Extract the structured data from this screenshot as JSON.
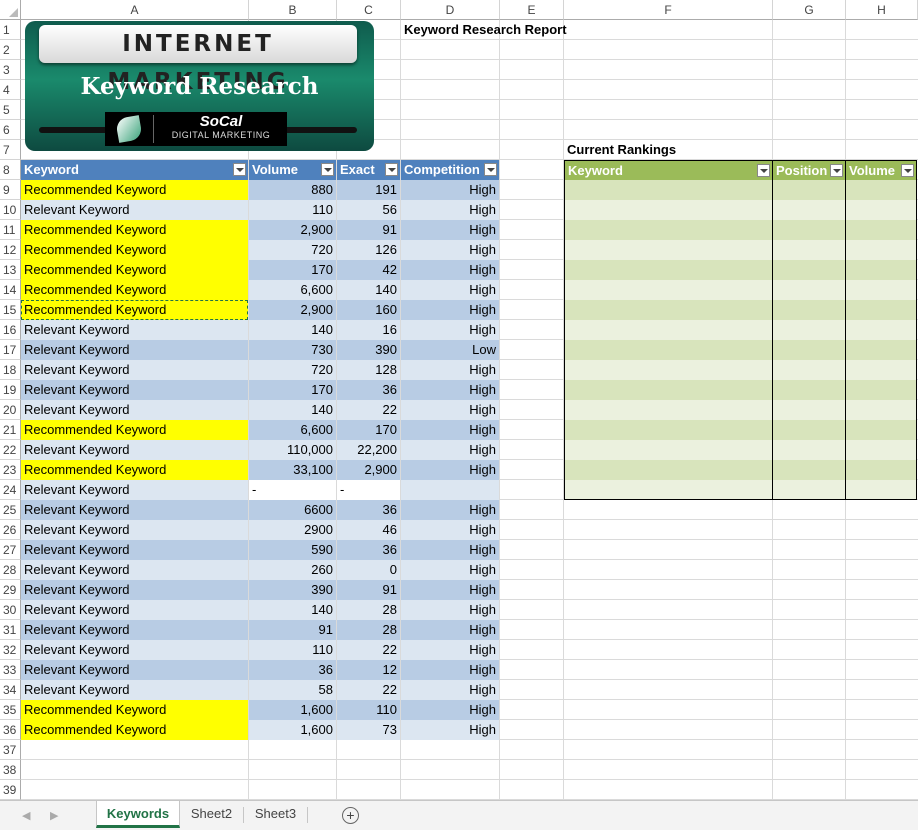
{
  "columns": [
    "A",
    "B",
    "C",
    "D",
    "E",
    "F",
    "G",
    "H"
  ],
  "title_cell": "Keyword Research Report",
  "logo": {
    "title": "INTERNET MARKETING",
    "subtitle": "Keyword Research",
    "brand": "SoCal",
    "brand_sub": "DIGITAL MARKETING"
  },
  "table": {
    "headers": [
      "Keyword",
      "Volume",
      "Exact",
      "Competition"
    ],
    "rows": [
      {
        "keyword": "Recommended Keyword",
        "volume": "880",
        "exact": "191",
        "competition": "High",
        "highlight": true
      },
      {
        "keyword": "Relevant Keyword",
        "volume": "110",
        "exact": "56",
        "competition": "High",
        "highlight": false
      },
      {
        "keyword": "Recommended Keyword",
        "volume": "2,900",
        "exact": "91",
        "competition": "High",
        "highlight": true
      },
      {
        "keyword": "Recommended Keyword",
        "volume": "720",
        "exact": "126",
        "competition": "High",
        "highlight": true
      },
      {
        "keyword": "Recommended Keyword",
        "volume": "170",
        "exact": "42",
        "competition": "High",
        "highlight": true
      },
      {
        "keyword": "Recommended Keyword",
        "volume": "6,600",
        "exact": "140",
        "competition": "High",
        "highlight": true
      },
      {
        "keyword": "Recommended Keyword",
        "volume": "2,900",
        "exact": "160",
        "competition": "High",
        "highlight": true
      },
      {
        "keyword": "Relevant Keyword",
        "volume": "140",
        "exact": "16",
        "competition": "High",
        "highlight": false
      },
      {
        "keyword": "Relevant Keyword",
        "volume": "730",
        "exact": "390",
        "competition": "Low",
        "highlight": false
      },
      {
        "keyword": "Relevant Keyword",
        "volume": "720",
        "exact": "128",
        "competition": "High",
        "highlight": false
      },
      {
        "keyword": "Relevant Keyword",
        "volume": "170",
        "exact": "36",
        "competition": "High",
        "highlight": false
      },
      {
        "keyword": "Relevant Keyword",
        "volume": "140",
        "exact": "22",
        "competition": "High",
        "highlight": false
      },
      {
        "keyword": "Recommended Keyword",
        "volume": "6,600",
        "exact": "170",
        "competition": "High",
        "highlight": true
      },
      {
        "keyword": "Relevant Keyword",
        "volume": "110,000",
        "exact": "22,200",
        "competition": "High",
        "highlight": false
      },
      {
        "keyword": "Recommended Keyword",
        "volume": "33,100",
        "exact": "2,900",
        "competition": "High",
        "highlight": true
      },
      {
        "keyword": "Relevant Keyword",
        "volume": "-",
        "exact": "-",
        "competition": "",
        "highlight": false
      },
      {
        "keyword": "Relevant Keyword",
        "volume": "6600",
        "exact": "36",
        "competition": "High",
        "highlight": false
      },
      {
        "keyword": "Relevant Keyword",
        "volume": "2900",
        "exact": "46",
        "competition": "High",
        "highlight": false
      },
      {
        "keyword": "Relevant Keyword",
        "volume": "590",
        "exact": "36",
        "competition": "High",
        "highlight": false
      },
      {
        "keyword": "Relevant Keyword",
        "volume": "260",
        "exact": "0",
        "competition": "High",
        "highlight": false
      },
      {
        "keyword": "Relevant Keyword",
        "volume": "390",
        "exact": "91",
        "competition": "High",
        "highlight": false
      },
      {
        "keyword": "Relevant Keyword",
        "volume": "140",
        "exact": "28",
        "competition": "High",
        "highlight": false
      },
      {
        "keyword": "Relevant Keyword",
        "volume": "91",
        "exact": "28",
        "competition": "High",
        "highlight": false
      },
      {
        "keyword": "Relevant Keyword",
        "volume": "110",
        "exact": "22",
        "competition": "High",
        "highlight": false
      },
      {
        "keyword": "Relevant Keyword",
        "volume": "36",
        "exact": "12",
        "competition": "High",
        "highlight": false
      },
      {
        "keyword": "Relevant Keyword",
        "volume": "58",
        "exact": "22",
        "competition": "High",
        "highlight": false
      },
      {
        "keyword": "Recommended Keyword",
        "volume": "1,600",
        "exact": "110",
        "competition": "High",
        "highlight": true
      },
      {
        "keyword": "Recommended Keyword",
        "volume": "1,600",
        "exact": "73",
        "competition": "High",
        "highlight": true
      }
    ]
  },
  "rankings": {
    "title": "Current Rankings",
    "headers": [
      "Keyword",
      "Position",
      "Volume"
    ],
    "empty_rows": 16
  },
  "row_count": 39,
  "sheet_tabs": [
    {
      "label": "Keywords",
      "active": true
    },
    {
      "label": "Sheet2",
      "active": false
    },
    {
      "label": "Sheet3",
      "active": false
    }
  ],
  "colors": {
    "table_header": "#4f81bd",
    "band_dark": "#b8cce4",
    "band_light": "#dce6f1",
    "highlight": "#ffff00",
    "rank_header": "#9bbb59",
    "rank_band_dark": "#d8e4bc",
    "rank_band_light": "#ebf1de",
    "active_tab": "#217346"
  }
}
